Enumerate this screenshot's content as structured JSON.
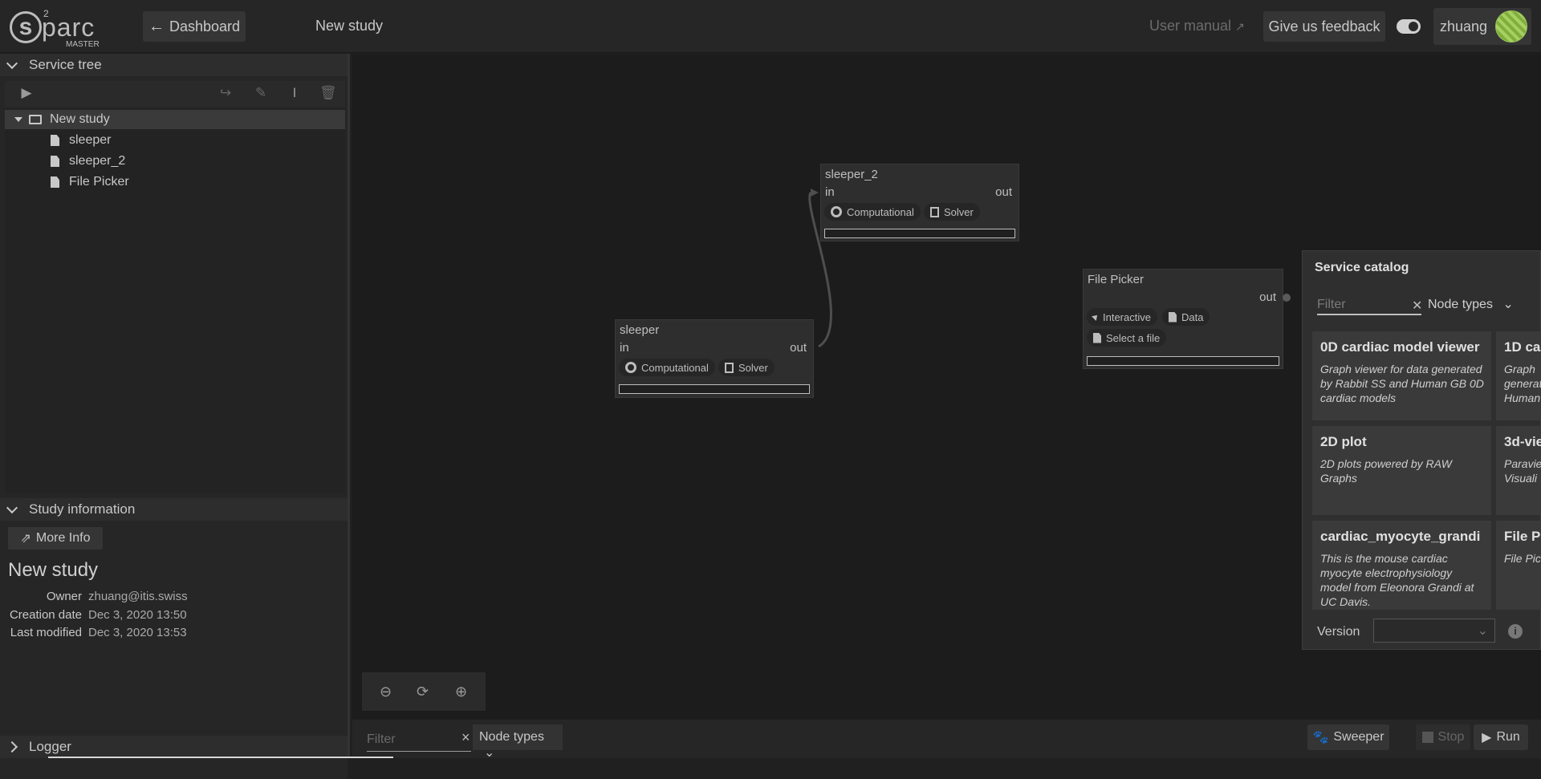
{
  "header": {
    "logo_letter": "s",
    "logo_sup": "2",
    "logo_text": "parc",
    "logo_sub": "MASTER",
    "dashboard_label": "Dashboard",
    "study_title": "New study",
    "user_manual": "User manual",
    "feedback": "Give us feedback",
    "username": "zhuang"
  },
  "service_tree": {
    "header": "Service tree",
    "root": "New study",
    "items": [
      "sleeper",
      "sleeper_2",
      "File Picker"
    ]
  },
  "study_info": {
    "header": "Study information",
    "more_info": "More Info",
    "title": "New study",
    "owner_label": "Owner",
    "owner": "zhuang@itis.swiss",
    "creation_label": "Creation date",
    "creation": "Dec 3, 2020 13:50",
    "modified_label": "Last modified",
    "modified": "Dec 3, 2020 13:53"
  },
  "logger": {
    "label": "Logger"
  },
  "nodes": {
    "sleeper": {
      "title": "sleeper",
      "in": "in",
      "out": "out",
      "tag1": "Computational",
      "tag2": "Solver"
    },
    "sleeper_2": {
      "title": "sleeper_2",
      "in": "in",
      "out": "out",
      "tag1": "Computational",
      "tag2": "Solver"
    },
    "file_picker": {
      "title": "File Picker",
      "out": "out",
      "tag1": "Interactive",
      "tag2": "Data",
      "tag3": "Select a file"
    }
  },
  "catalog": {
    "title": "Service catalog",
    "filter_placeholder": "Filter",
    "node_types": "Node types",
    "version_label": "Version",
    "cards": [
      {
        "title": "0D cardiac model viewer",
        "desc": "Graph viewer for data generated by Rabbit SS and Human GB 0D cardiac models"
      },
      {
        "title": "1D ca",
        "desc": "Graph generat Human"
      },
      {
        "title": "2D plot",
        "desc": "2D plots powered by RAW Graphs"
      },
      {
        "title": "3d-vie",
        "desc": "Paravie Visuali"
      },
      {
        "title": "cardiac_myocyte_grandi",
        "desc": "This is the mouse cardiac myocyte electrophysiology model from Eleonora Grandi at UC Davis."
      },
      {
        "title": "File Pi",
        "desc": "File Pic"
      }
    ]
  },
  "bottombar": {
    "filter_placeholder": "Filter",
    "node_types": "Node types",
    "sweeper": "Sweeper",
    "stop": "Stop",
    "run": "Run"
  }
}
